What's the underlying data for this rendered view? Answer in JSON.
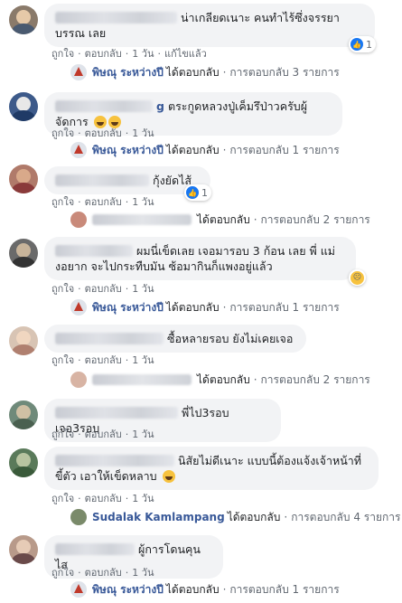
{
  "actions": {
    "like": "ถูกใจ",
    "reply": "ตอบกลับ",
    "dot": "·",
    "time_1_day": "1 วัน",
    "edited": "แก้ไขแล้ว"
  },
  "comments": [
    {
      "name_partial": "",
      "text": "น่าเกลียดเนาะ คนทำไร้ซึ่งจรรยาบรรณ เลย",
      "reaction_count": "1",
      "reply_by": "พิษณุ ระหว่างปี",
      "reply_verb": "ได้ตอบกลับ",
      "reply_count": "การตอบกลับ 3 รายการ"
    },
    {
      "name_partial": "g",
      "text": "ตระกูดหลวงปู่เค็มรึป่าวครับผู้จัดการ",
      "reply_by": "พิษณุ ระหว่างปี",
      "reply_verb": "ได้ตอบกลับ",
      "reply_count": "การตอบกลับ 1 รายการ"
    },
    {
      "name_partial": "",
      "text": "กุ้งยัดไส้",
      "reaction_count": "1",
      "reply_by": "",
      "reply_verb": "ได้ตอบกลับ",
      "reply_count": "การตอบกลับ 2 รายการ"
    },
    {
      "name_partial": "",
      "text": "ผมนี่เข็ดเลย เจอมารอบ 3 ก้อน เลย พี่ แม่งอยาก จะไปกระทืบมัน ซ้อมากินก็แพงอยู่แล้ว",
      "reply_by": "พิษณุ ระหว่างปี",
      "reply_verb": "ได้ตอบกลับ",
      "reply_count": "การตอบกลับ 1 รายการ"
    },
    {
      "name_partial": "",
      "text": "ซื้อหลายรอบ ยังไม่เคยเจอ",
      "reply_by": "",
      "reply_verb": "ได้ตอบกลับ",
      "reply_count": "การตอบกลับ 2 รายการ"
    },
    {
      "name_partial": "",
      "text": "พี่ไป3รอบเจอ3รอบ"
    },
    {
      "name_partial": "",
      "text": "นิสัยไม่ดีเนาะ แบบนี้ต้องแจ้งเจ้าหน้าที่ ขี้ตัว เอาให้เข็ดหลาบ",
      "reply_by": "Sudalak Kamlampang",
      "reply_verb": "ได้ตอบกลับ",
      "reply_count": "การตอบกลับ 4 รายการ"
    },
    {
      "name_partial": "",
      "text": "ผู้การโดนคุนไส",
      "reply_by": "พิษณุ ระหว่างปี",
      "reply_verb": "ได้ตอบกลับ",
      "reply_count": "การตอบกลับ 1 รายการ"
    }
  ],
  "colors": {
    "bubble_bg": "#f2f3f5",
    "name_link": "#385898",
    "secondary_text": "#606770",
    "like_blue": "#1877f2"
  }
}
